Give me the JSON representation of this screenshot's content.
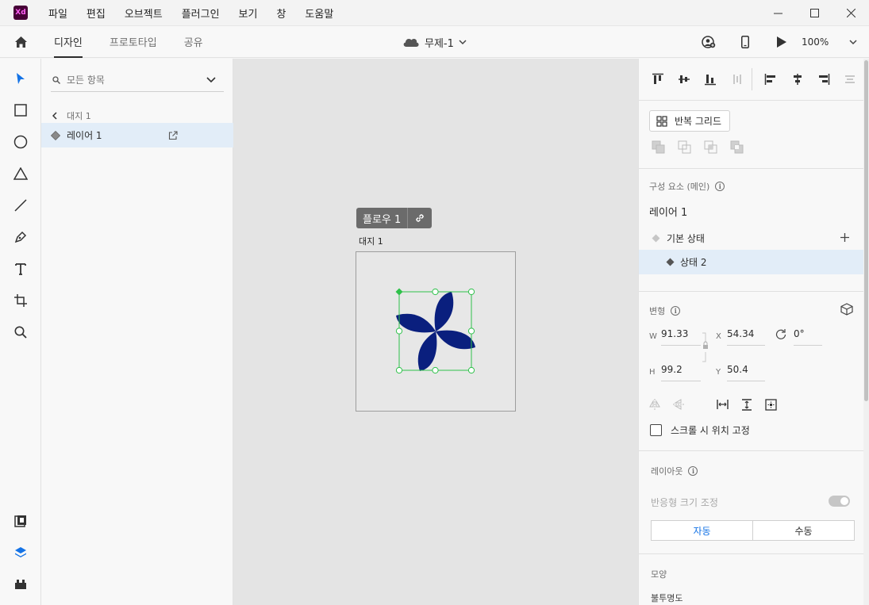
{
  "menu": [
    "파일",
    "편집",
    "오브젝트",
    "플러그인",
    "보기",
    "창",
    "도움말"
  ],
  "app_logo": "Xd",
  "modes": [
    "디자인",
    "프로토타입",
    "공유"
  ],
  "doc_title": "무제-1",
  "zoom": "100%",
  "layers": {
    "search_placeholder": "모든 항목",
    "breadcrumb": "대지 1",
    "items": [
      {
        "label": "레이어 1"
      }
    ]
  },
  "canvas": {
    "flow_label": "플로우 1",
    "artboard_label": "대지 1",
    "pinwheel_color": "#0a1f7e",
    "selection_color": "#2fc14b"
  },
  "props": {
    "repeat_grid": "반복 그리드",
    "component_title": "구성 요소 (메인)",
    "component_name": "레이어 1",
    "default_state": "기본 상태",
    "state_2": "상태 2",
    "transform_title": "변형",
    "w_label": "W",
    "w_value": "91.33",
    "x_label": "X",
    "x_value": "54.34",
    "rotation": "0°",
    "h_label": "H",
    "h_value": "99.2",
    "y_label": "Y",
    "y_value": "50.4",
    "fix_position": "스크롤 시 위치 고정",
    "layout_title": "레이아웃",
    "responsive": "반응형 크기 조정",
    "auto": "자동",
    "manual": "수동",
    "appearance_title": "모양",
    "opacity_label": "불투명도"
  }
}
